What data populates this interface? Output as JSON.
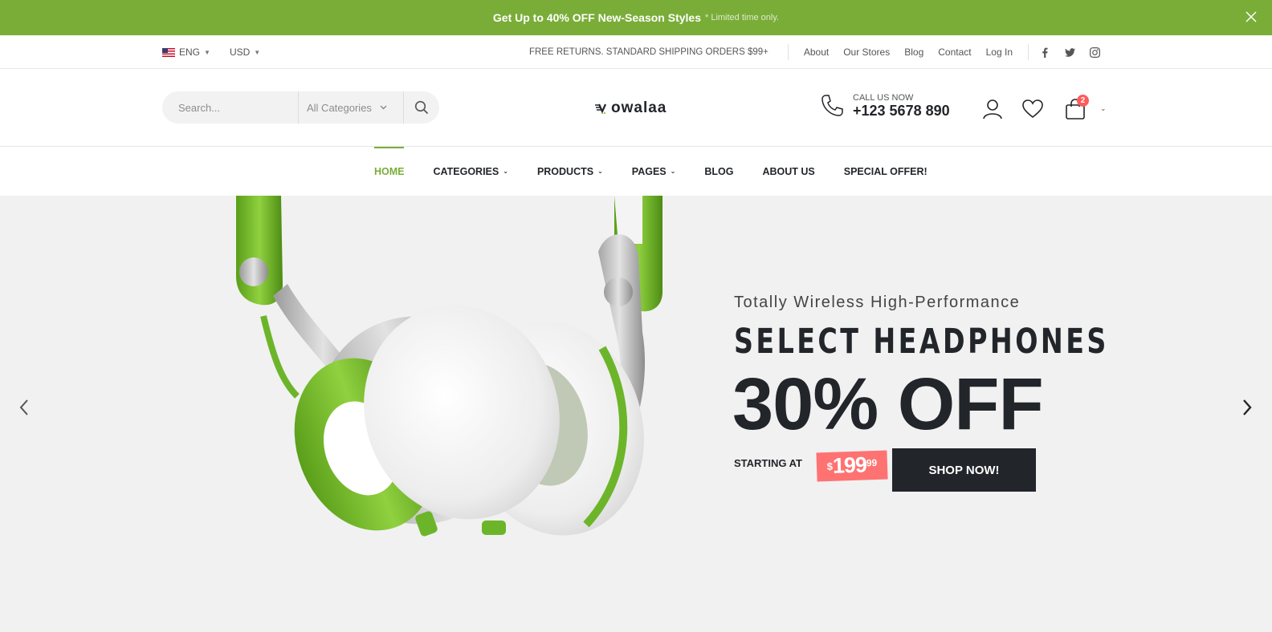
{
  "promo": {
    "prefix": "Get Up to",
    "highlight": "40% OFF",
    "suffix": "New-Season Styles",
    "note": "* Limited time only."
  },
  "topbar": {
    "language": "ENG",
    "currency": "USD",
    "shipping": "FREE RETURNS. STANDARD SHIPPING ORDERS $99+",
    "links": [
      "About",
      "Our Stores",
      "Blog",
      "Contact",
      "Log In"
    ],
    "social_icons": [
      "facebook-icon",
      "twitter-icon",
      "instagram-icon"
    ]
  },
  "header": {
    "search_placeholder": "Search...",
    "category": "All Categories",
    "logo": "owalaa",
    "call_label": "CALL US NOW",
    "phone": "+123 5678 890",
    "cart_count": "2"
  },
  "nav": {
    "items": [
      "HOME",
      "CATEGORIES",
      "PRODUCTS",
      "PAGES",
      "BLOG",
      "ABOUT US",
      "SPECIAL OFFER!"
    ]
  },
  "hero": {
    "subtitle": "Totally Wireless High-Performance",
    "title": "SELECT HEADPHONES",
    "offer": "30% OFF",
    "starting_label": "STARTING AT",
    "price_currency": "$",
    "price_dollars": "199",
    "price_cents": "99",
    "cta": "SHOP NOW!"
  },
  "colors": {
    "accent": "#7aad38",
    "dark": "#222529",
    "price_tag": "#ff7272",
    "badge": "#ff5b5b"
  }
}
